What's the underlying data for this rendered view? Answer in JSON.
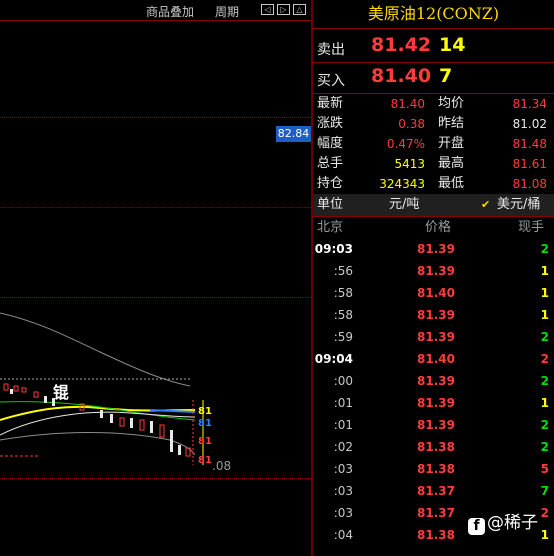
{
  "toolbar": {
    "overlay_label": "商品叠加",
    "period_label": "周期",
    "nav_left": "◁",
    "nav_right": "▷",
    "nav_up": "△"
  },
  "chart": {
    "price_tag": "82.84",
    "stamp_char": "锟",
    "right_labels": [
      "81",
      "81",
      "81",
      "81",
      ".08"
    ]
  },
  "quote": {
    "title": "美原油12(CONZ)",
    "ask": {
      "label": "卖出",
      "price": "81.42",
      "volume": "14"
    },
    "bid": {
      "label": "买入",
      "price": "81.40",
      "volume": "7"
    },
    "stats": [
      {
        "label": "最新",
        "value": "81.40",
        "label2": "均价",
        "value2": "81.34"
      },
      {
        "label": "涨跌",
        "value": "0.38",
        "label2": "昨结",
        "value2": "81.02"
      },
      {
        "label": "幅度",
        "value": "0.47%",
        "label2": "开盘",
        "value2": "81.48"
      },
      {
        "label": "总手",
        "value": "5413",
        "label2": "最高",
        "value2": "81.61"
      },
      {
        "label": "持仓",
        "value": "324343",
        "label2": "最低",
        "value2": "81.08"
      }
    ],
    "unit": {
      "label": "单位",
      "value": "元/吨",
      "check": "✔",
      "alt": "美元/桶"
    },
    "ticks_header": {
      "time": "北京",
      "price": "价格",
      "qty": "现手"
    },
    "ticks": [
      {
        "time": "09:03",
        "price": "81.39",
        "qty": "2"
      },
      {
        "time": ":56",
        "price": "81.39",
        "qty": "1"
      },
      {
        "time": ":58",
        "price": "81.40",
        "qty": "1"
      },
      {
        "time": ":58",
        "price": "81.39",
        "qty": "1"
      },
      {
        "time": ":59",
        "price": "81.39",
        "qty": "2"
      },
      {
        "time": "09:04",
        "price": "81.40",
        "qty": "2"
      },
      {
        "time": ":00",
        "price": "81.39",
        "qty": "2"
      },
      {
        "time": ":01",
        "price": "81.39",
        "qty": "1"
      },
      {
        "time": ":01",
        "price": "81.39",
        "qty": "2"
      },
      {
        "time": ":02",
        "price": "81.38",
        "qty": "2"
      },
      {
        "time": ":03",
        "price": "81.38",
        "qty": "5"
      },
      {
        "time": ":03",
        "price": "81.37",
        "qty": "7"
      },
      {
        "time": ":03",
        "price": "81.37",
        "qty": "2"
      },
      {
        "time": ":04",
        "price": "81.38",
        "qty": "1"
      }
    ]
  },
  "watermark": {
    "icon": "f",
    "text": "@稀子"
  },
  "colors": {
    "up": "#ff3c3c",
    "volume": "#ffff00",
    "down": "#00e000",
    "grid": "#8a0000",
    "tag": "#1f5fc5"
  }
}
